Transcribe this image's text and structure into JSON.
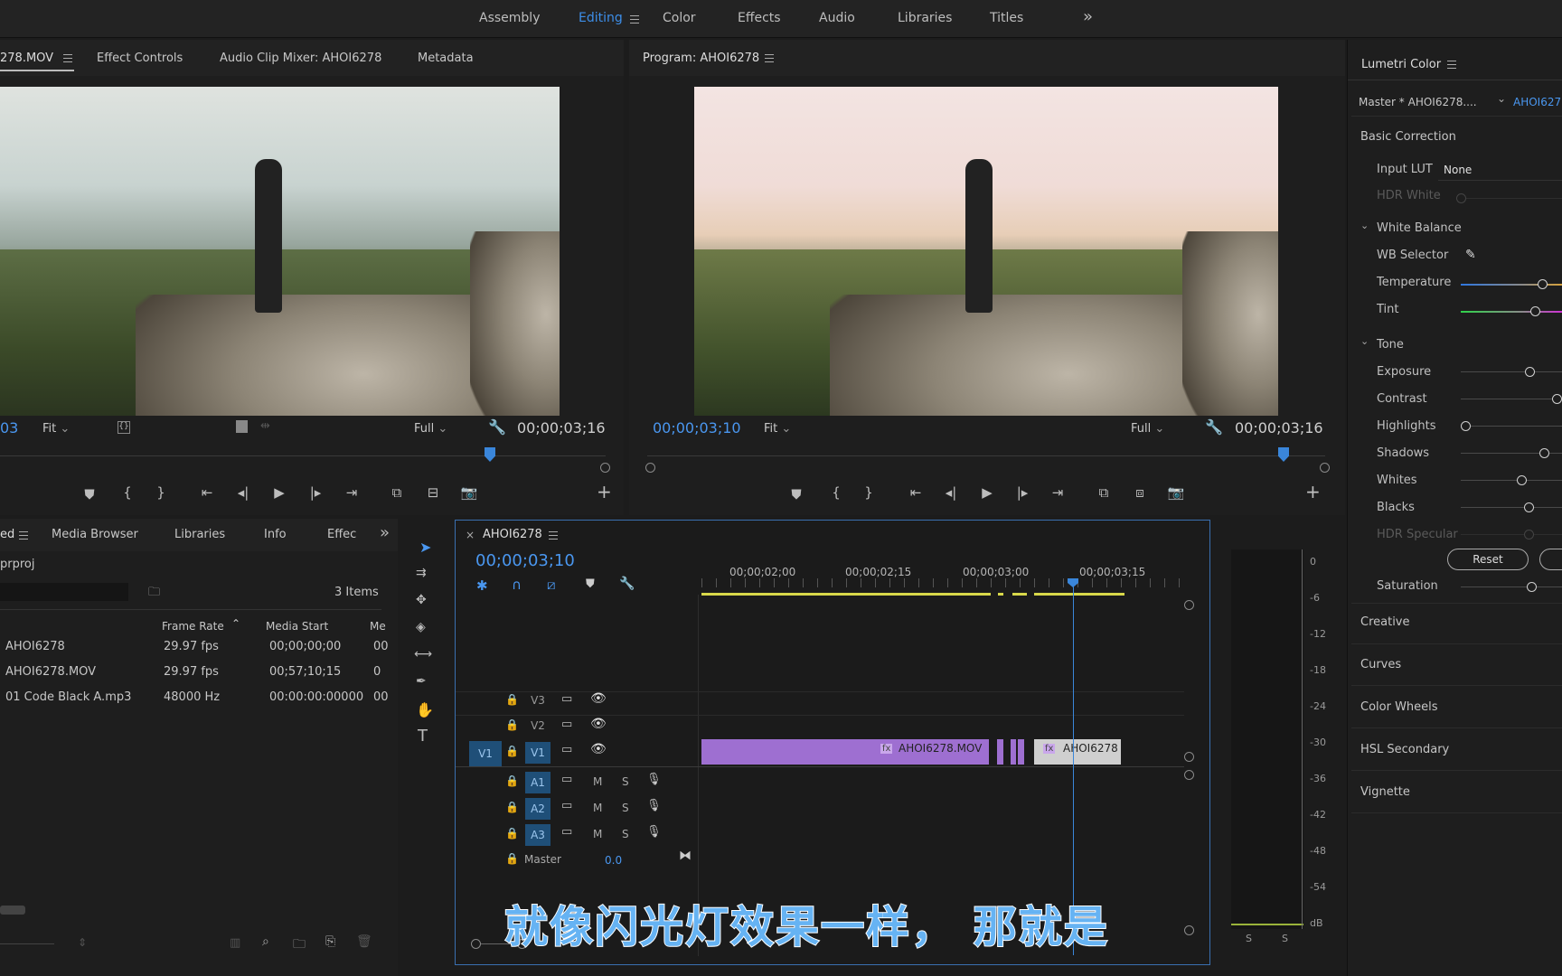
{
  "workspaces": {
    "items": [
      "Assembly",
      "Editing",
      "Color",
      "Effects",
      "Audio",
      "Libraries",
      "Titles"
    ],
    "active": "Editing",
    "more": "»"
  },
  "source_panel": {
    "tabs": [
      "278.MOV",
      "Effect Controls",
      "Audio Clip Mixer: AHOI6278",
      "Metadata"
    ],
    "timecode_left": "03",
    "fit": "Fit",
    "full": "Full",
    "timecode_right": "00;00;03;16"
  },
  "program_panel": {
    "title": "Program: AHOI6278",
    "timecode_left": "00;00;03;10",
    "fit": "Fit",
    "full": "Full",
    "timecode_right": "00;00;03;16"
  },
  "project_panel": {
    "tabs": [
      "ed",
      "Media Browser",
      "Libraries",
      "Info",
      "Effec"
    ],
    "project_file": "prproj",
    "items_count": "3 Items",
    "columns": [
      "Frame Rate",
      "Media Start",
      "Me"
    ],
    "rows": [
      {
        "name": "AHOI6278",
        "rate": "29.97 fps",
        "start": "00;00;00;00",
        "m": "00"
      },
      {
        "name": "AHOI6278.MOV",
        "rate": "29.97 fps",
        "start": "00;57;10;15",
        "m": "0"
      },
      {
        "name": "01 Code Black A.mp3",
        "rate": "48000 Hz",
        "start": "00:00:00:00000",
        "m": "00"
      }
    ]
  },
  "timeline": {
    "title": "AHOI6278",
    "timecode": "00;00;03;10",
    "ruler": [
      "00;00;02;00",
      "00;00;02;15",
      "00;00;03;00",
      "00;00;03;15"
    ],
    "tracks": {
      "video": [
        "V3",
        "V2",
        "V1"
      ],
      "audio": [
        "A1",
        "A2",
        "A3"
      ],
      "source_v": "V1",
      "m": "M",
      "s": "S",
      "master": "Master",
      "master_val": "0.0"
    },
    "clips": [
      {
        "label": "AHOI6278.MOV",
        "fx": "fx"
      },
      {
        "label": "AHOI6278",
        "fx": "fx"
      }
    ]
  },
  "meter": {
    "scale": [
      "0",
      "-6",
      "-12",
      "-18",
      "-24",
      "-30",
      "-36",
      "-42",
      "-48",
      "-54",
      "dB"
    ],
    "solo": [
      "S",
      "S"
    ]
  },
  "lumetri": {
    "title": "Lumetri Color",
    "master": "Master * AHOI6278....",
    "clip": "AHOI627",
    "basic": "Basic Correction",
    "input_lut_label": "Input LUT",
    "input_lut": "None",
    "hdr_white": "HDR White",
    "white_balance": "White Balance",
    "wb_selector": "WB Selector",
    "temperature": "Temperature",
    "tint": "Tint",
    "tone": "Tone",
    "tone_items": [
      "Exposure",
      "Contrast",
      "Highlights",
      "Shadows",
      "Whites",
      "Blacks"
    ],
    "hdr_specular": "HDR Specular",
    "reset": "Reset",
    "saturation": "Saturation",
    "sections": [
      "Creative",
      "Curves",
      "Color Wheels",
      "HSL Secondary",
      "Vignette"
    ]
  },
  "subtitle": "就像闪光灯效果一样， 那就是"
}
